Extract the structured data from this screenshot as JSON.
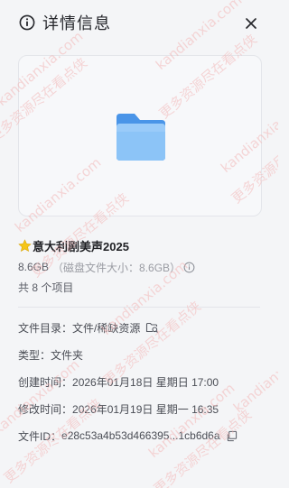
{
  "header": {
    "title": "详情信息"
  },
  "file": {
    "name": "意大利剧美声2025",
    "size": "8.6GB",
    "disk_size": "（磁盘文件大小：8.6GB）",
    "item_count": "共 8 个项目"
  },
  "meta": {
    "directory_label": "文件目录：",
    "directory_value": "文件/稀缺资源",
    "type_label": "类型：",
    "type_value": "文件夹",
    "created_label": "创建时间：",
    "created_value": "2026年01月18日 星期日 17:00",
    "modified_label": "修改时间：",
    "modified_value": "2026年01月19日 星期一 16:35",
    "id_label": "文件ID：",
    "id_value": "e28c53a4b53d466395...1cb6d6a"
  },
  "watermark": {
    "texts": [
      "kandianxia.com",
      "更多资源尽在看点侠"
    ]
  },
  "colors": {
    "background": "#f4f5f7",
    "folder_front": "#7ab8f5",
    "folder_back": "#4a95e8",
    "watermark": "#f3b8b8",
    "star": "#f5c518"
  }
}
